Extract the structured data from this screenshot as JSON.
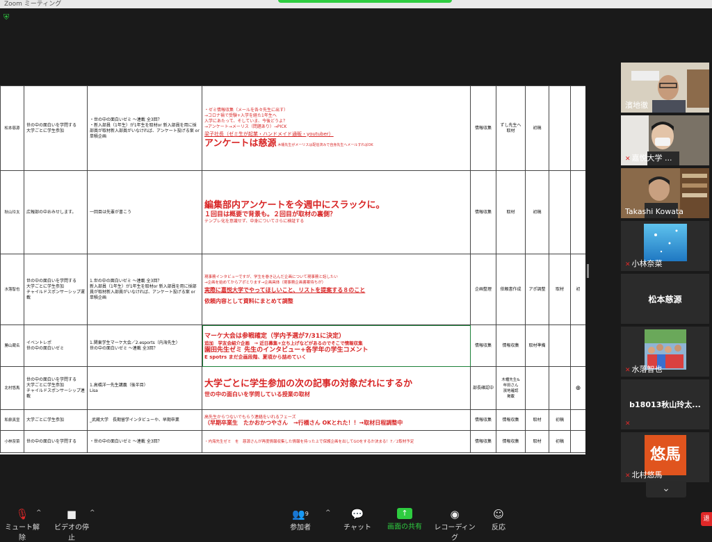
{
  "window": {
    "title": "Zoom ミーティング"
  },
  "sheet": {
    "rows": [
      {
        "name": "松本慈源",
        "theme": "世の中の面白いを学問する\n大学ごとに学生参加",
        "plan": "・世の中の面白いゼミ 〜連載 全3回？\n・新入部員（1年生）が1年生を取材or 新入部員を用に採部員が取材新入部員がいなければ、アンケート投げる案 or 単積企画",
        "progress_small": "・ゼミ情報収集（メールを各々先生に出す）\n→コロナ禍で受験+入学を経た1年生へ\n入学にあたって、そしていま、今後どうよ？\n→アンケート→メーリス（問題あり）→PICK",
        "progress_big": "アンケートは慈源",
        "progress_note": "木幡先生がメーリスは配信済みで自身先生へメールすればOK",
        "progress_link": "梁子社長（ゼミ生が起業・ハンドメイド通販・youtuber）",
        "status": "情報収集",
        "next": "ずし先生へ取材",
        "stage": "初稿",
        "c4": "",
        "c5": ""
      },
      {
        "name": "秋山玲太",
        "theme": "広報部の中おみせします。",
        "plan": "一回目は先輩が書こう",
        "progress_big": "編集部内アンケートを今週中にスラックに。",
        "progress_mid": "１回目は概要で背景も。２回目が取材の裏側？",
        "progress_small": "テンプレ化を意識せず、中身についてさらに検証する",
        "status": "情報収集",
        "next": "取材",
        "stage": "初稿",
        "c4": "",
        "c5": ""
      },
      {
        "name": "水落智也",
        "theme": "世の中の面白いを学問する\n大学ごとに学生参加\nチャイルドスポンサーシップ運載",
        "plan": "1.世の中の面白いゼミ 〜連載 全3回？\n新入部員（1年生）が1年生を取材or 新入部員を用に採部員が取材新入部員がいなければ、アンケート投げる案 or 単積企画",
        "progress_small": "現事務インタビューですが、学生を巻き込んだ企画について現事務と話したい\n→企画を始めてからアポとります→企画具体（現事務企画書案待ちが）",
        "progress_link": "実際に嘉悦大学でやってほしいこと、リストを提案する８のこと",
        "progress_mid": "依頼内容として資料にまとめて調整",
        "status": "企画整理",
        "next": "依頼書作成",
        "stage": "アポ調整",
        "c4": "取材",
        "c5": "初"
      },
      {
        "name": "勝山蔵名",
        "theme": "イベントレポ\n世の中の面白いゼミ",
        "plan": "1.関東学生マーケ大会／2.esports（内海先生）\n世の中の面白いゼミ 〜連載 全3回？",
        "progress_l1": "マーケ大会は参戦確定（学内予選が7/31に決定）",
        "progress_l2": "追加　学友会紹介企画　→ 近日募集+立ち上げなどがあるのでそこで情報収集",
        "progress_l3": "園田先生ゼミ 先生のインタビュー+各学年の学生コメント",
        "progress_l4": "E spotrs まだ企画段階、夏頃から詰めていく",
        "status": "情報収集",
        "next": "情報収集",
        "stage": "取材準備",
        "c4": "",
        "c5": ""
      },
      {
        "name": "北村悠馬",
        "theme": "世の中の面白いを学問する\n大学ごとに学生参加\nチャイルドスポンサーシップ連載",
        "plan": "1.高橋洋一先生講義（後半目）\nLisa",
        "progress_big": "大学ごとに学生参加の次の記事の対象だれにするか",
        "progress_mid": "世の中の面白いを学問している授業の取材",
        "status": "部長確認中",
        "next": "木幡先生&\n牟田さん\n濱地確認\n掲載",
        "stage": "",
        "c4": "",
        "c5": "⊕"
      },
      {
        "name": "和泉真宣",
        "theme": "大学ごとに学生参加",
        "plan": "_武蔵大学　長期留学インタビューや、早期卒業",
        "progress_l1": "高先生からつないでもらう連絡をいれるフェーズ",
        "progress_l2": "（早期卒業生　たかおかつやさん　→行橋さん OKとれた！！→取材日程調整中",
        "status": "情報収集",
        "next": "情報収集",
        "stage": "取材",
        "c4": "初稿",
        "c5": ""
      },
      {
        "name": "小林奈菜",
        "theme": "世の中の面白いを学問する",
        "plan": "・世の中の面白いゼミ 〜連載 全3回？",
        "progress_small": "・内海先生ゼミ　を　慈源さんが再度情報収集した情報を持った上で保護企画を出してGOをするか決まる！7／2取材予定",
        "status": "情報収集",
        "next": "情報収集",
        "stage": "取材",
        "c4": "初稿",
        "c5": ""
      }
    ]
  },
  "participants": [
    {
      "name": "濱地徹",
      "active": true,
      "muted": false,
      "video": true,
      "skin": "#c69b7b",
      "bg": "#d8d0c0"
    },
    {
      "name": "嘉悦大学 ...",
      "active": false,
      "muted": true,
      "video": true,
      "skin": "#e3c4a8",
      "bg": "#7a7266"
    },
    {
      "name": "Takashi Kowata",
      "active": false,
      "muted": false,
      "video": true,
      "skin": "#c8a080",
      "bg": "#8a6a4a"
    },
    {
      "name": "小林奈菜",
      "active": false,
      "muted": true,
      "video": false,
      "avatar": "ocean"
    },
    {
      "name": "松本慈源",
      "active": false,
      "muted": false,
      "video": false,
      "center": true
    },
    {
      "name": "水落智也",
      "active": false,
      "muted": true,
      "video": false,
      "avatar": "group"
    },
    {
      "name": "b18013秋山玲太...",
      "active": false,
      "muted": true,
      "video": false,
      "center": true
    },
    {
      "name": "北村悠馬",
      "active": false,
      "muted": true,
      "video": false,
      "avatar": "text",
      "avatar_text": "悠馬"
    }
  ],
  "toolbar": {
    "mute": "ミュート解除",
    "video": "ビデオの停止",
    "participants": "参加者",
    "participants_count": "9",
    "chat": "チャット",
    "share": "画面の共有",
    "record": "レコーディング",
    "reactions": "反応",
    "end": "退"
  },
  "colors": {
    "accent_green": "#2ecc40",
    "active_border": "#e8d53b",
    "mute_red": "#e02828",
    "sheet_red": "#d82424"
  }
}
